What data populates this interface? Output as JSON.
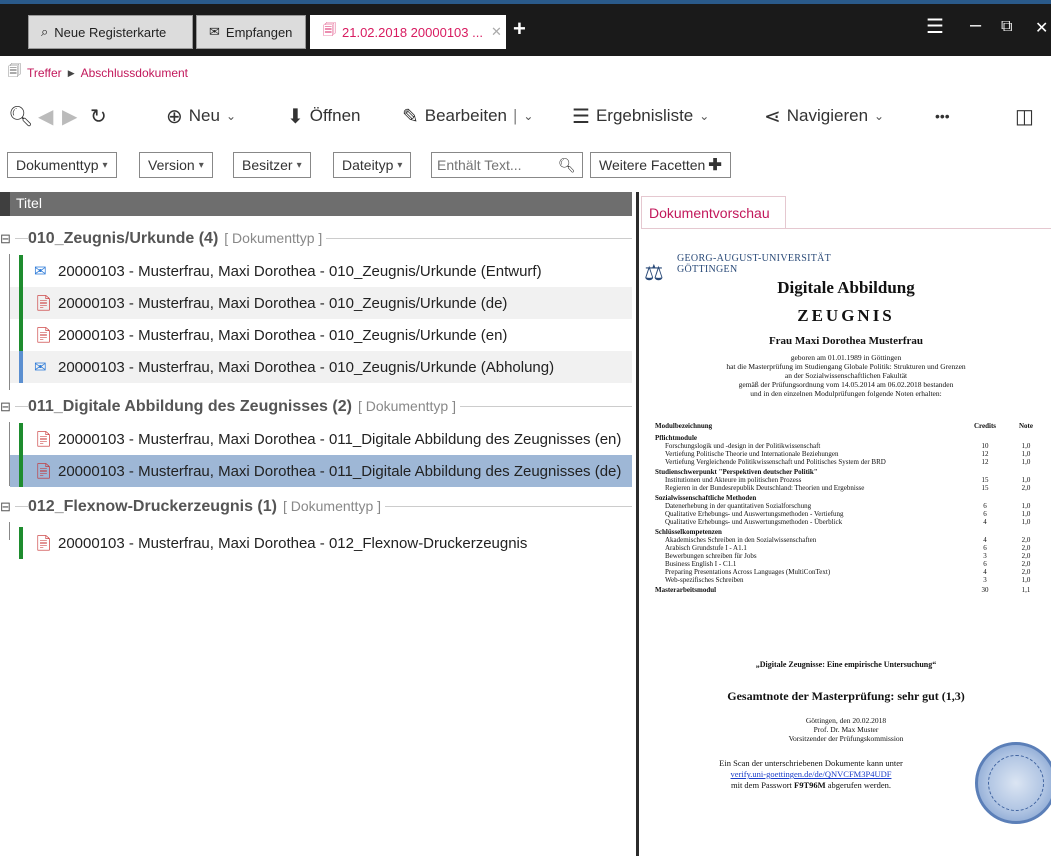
{
  "tabs": [
    {
      "label": "Neue Registerkarte",
      "icon": "search-doc-icon"
    },
    {
      "label": "Empfangen",
      "icon": "mail-icon"
    },
    {
      "label": "21.02.2018 20000103 ...",
      "icon": "documents-icon",
      "active": true
    }
  ],
  "window": {
    "menu": "☰",
    "minimize": "–",
    "restore": "⧉",
    "close": "✕"
  },
  "breadcrumb": {
    "first": "Treffer",
    "second": "Abschlussdokument"
  },
  "toolbar": {
    "neu": "Neu",
    "oeffnen": "Öffnen",
    "bearbeiten": "Bearbeiten",
    "ergebnisliste": "Ergebnisliste",
    "navigieren": "Navigieren",
    "more": "•••"
  },
  "facets": {
    "dokumenttyp": "Dokumenttyp",
    "version": "Version",
    "besitzer": "Besitzer",
    "dateityp": "Dateityp",
    "search_placeholder": "Enthält Text...",
    "weitere": "Weitere Facetten"
  },
  "list": {
    "header": "Titel",
    "groups": [
      {
        "title": "010_Zeugnis/Urkunde (4)",
        "type": "[ Dokumenttyp ]",
        "rows": [
          "20000103 - Musterfrau, Maxi Dorothea - 010_Zeugnis/Urkunde (Entwurf)",
          "20000103 - Musterfrau, Maxi Dorothea - 010_Zeugnis/Urkunde (de)",
          "20000103 - Musterfrau, Maxi Dorothea - 010_Zeugnis/Urkunde (en)",
          "20000103 - Musterfrau, Maxi Dorothea - 010_Zeugnis/Urkunde (Abholung)"
        ]
      },
      {
        "title": "011_Digitale Abbildung des Zeugnisses (2)",
        "type": "[ Dokumenttyp ]",
        "rows": [
          "20000103 - Musterfrau, Maxi Dorothea - 011_Digitale Abbildung des Zeugnisses (en)",
          "20000103 - Musterfrau, Maxi Dorothea - 011_Digitale Abbildung des Zeugnisses (de)"
        ]
      },
      {
        "title": "012_Flexnow-Druckerzeugnis (1)",
        "type": "[ Dokumenttyp ]",
        "rows": [
          "20000103 - Musterfrau, Maxi Dorothea - 012_Flexnow-Druckerzeugnis"
        ]
      }
    ]
  },
  "preview": {
    "tab": "Dokumentvorschau",
    "uni_line1": "GEORG-AUGUST-UNIVERSITÄT",
    "uni_line2": "GÖTTINGEN",
    "title": "Digitale Abbildung",
    "subtitle": "ZEUGNIS",
    "name": "Frau Maxi Dorothea Musterfrau",
    "intro1": "geboren am 01.01.1989 in Göttingen",
    "intro2": "hat die Masterprüfung im Studiengang Globale Politik: Strukturen und Grenzen",
    "intro3": "an der Sozialwissenschaftlichen Fakultät",
    "intro4": "gemäß der Prüfungsordnung vom 14.05.2014 am 06.02.2018 bestanden",
    "intro5": "und in den einzelnen Modulprüfungen folgende Noten erhalten:",
    "col_module": "Modulbezeichnung",
    "col_credits": "Credits",
    "col_note": "Note",
    "sections": [
      {
        "name": "Pflichtmodule",
        "rows": [
          {
            "m": "Forschungslogik und -design in der Politikwissenschaft",
            "c": "10",
            "n": "1,0"
          },
          {
            "m": "Vertiefung Politische Theorie und Internationale Beziehungen",
            "c": "12",
            "n": "1,0"
          },
          {
            "m": "Vertiefung Vergleichende Politikwissenschaft und Politisches System der BRD",
            "c": "12",
            "n": "1,0"
          }
        ]
      },
      {
        "name": "Studienschwerpunkt \"Perspektiven deutscher Politik\"",
        "rows": [
          {
            "m": "Institutionen und Akteure im politischen Prozess",
            "c": "15",
            "n": "1,0"
          },
          {
            "m": "Regieren in der Bundesrepublik Deutschland: Theorien und Ergebnisse",
            "c": "15",
            "n": "2,0"
          }
        ]
      },
      {
        "name": "Sozialwissenschaftliche Methoden",
        "rows": [
          {
            "m": "Datenerhebung in der quantitativen Sozialforschung",
            "c": "6",
            "n": "1,0"
          },
          {
            "m": "Qualitative Erhebungs- und Auswertungsmethoden - Vertiefung",
            "c": "6",
            "n": "1,0"
          },
          {
            "m": "Qualitative Erhebungs- und Auswertungsmethoden - Überblick",
            "c": "4",
            "n": "1,0"
          }
        ]
      },
      {
        "name": "Schlüsselkompetenzen",
        "rows": [
          {
            "m": "Akademisches Schreiben in den Sozialwissenschaften",
            "c": "4",
            "n": "2,0"
          },
          {
            "m": "Arabisch Grundstufe I - A1.1",
            "c": "6",
            "n": "2,0"
          },
          {
            "m": "Bewerbungen schreiben für Jobs",
            "c": "3",
            "n": "2,0"
          },
          {
            "m": "Business English I - C1.1",
            "c": "6",
            "n": "2,0"
          },
          {
            "m": "Preparing Presentations Across Languages (MultiConText)",
            "c": "4",
            "n": "2,0"
          },
          {
            "m": "Web-spezifisches Schreiben",
            "c": "3",
            "n": "1,0"
          }
        ]
      }
    ],
    "master_label": "Masterarbeitsmodul",
    "master_credits": "30",
    "master_note": "1,1",
    "thesis": "„Digitale Zeugnisse: Eine empirische Untersuchung“",
    "overall": "Gesamtnote der Masterprüfung: sehr gut (1,3)",
    "sign1": "Göttingen, den 20.02.2018",
    "sign2": "Prof. Dr. Max Muster",
    "sign3": "Vorsitzender der Prüfungskommission",
    "scan1": "Ein Scan der unterschriebenen Dokumente kann unter",
    "scan_link": "verify.uni-goettingen.de/de/QNVCFM3P4UDF",
    "scan2_prefix": "mit dem Passwort",
    "scan2_pw": "F9T96M",
    "scan2_suffix": "abgerufen werden."
  }
}
